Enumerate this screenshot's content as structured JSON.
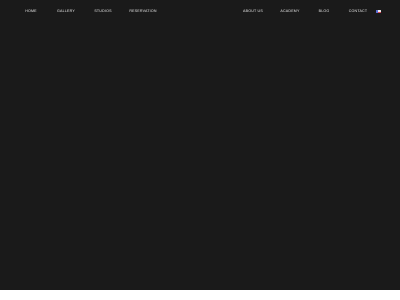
{
  "nav": {
    "home": "HOME",
    "gallery": "GALLERY",
    "studios": "STUDIOS",
    "reservation": "RESERVATION",
    "about": "ABOUT US",
    "academy": "ACADEMY",
    "blog": "BLOG",
    "contact": "CONTACT",
    "language_icon": "language-flag-icon"
  },
  "colors": {
    "background": "#1a1a1a",
    "nav_text": "#e6e6e6"
  }
}
